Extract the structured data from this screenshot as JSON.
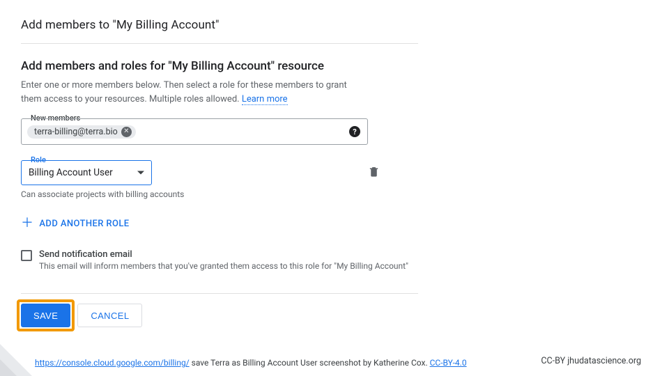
{
  "dialog": {
    "title": "Add members to \"My Billing Account\"",
    "section_title": "Add members and roles for \"My Billing Account\" resource",
    "section_desc": "Enter one or more members below. Then select a role for these members to grant them access to your resources. Multiple roles allowed. ",
    "learn_more": "Learn more"
  },
  "members": {
    "label": "New members",
    "chip_value": "terra-billing@terra.bio"
  },
  "role": {
    "label": "Role",
    "selected": "Billing Account User",
    "hint": "Can associate projects with billing accounts"
  },
  "add_role": "ADD ANOTHER ROLE",
  "notify": {
    "label": "Send notification email",
    "desc": "This email will inform members that you've granted them access to this role for \"My Billing Account\""
  },
  "buttons": {
    "save": "SAVE",
    "cancel": "CANCEL"
  },
  "attribution": {
    "url_text": "https://console.cloud.google.com/billing/",
    "caption": " save Terra as Billing Account User  screenshot  by Katherine Cox. ",
    "license": "CC-BY-4.0",
    "right": "CC-BY  jhudatascience.org"
  }
}
